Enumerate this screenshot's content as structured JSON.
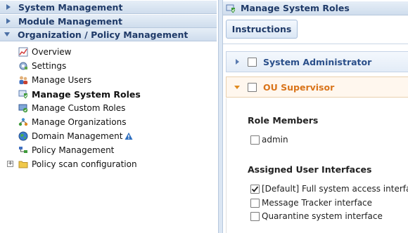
{
  "left": {
    "accordion": [
      {
        "label": "System Management",
        "expanded": false
      },
      {
        "label": "Module Management",
        "expanded": false
      },
      {
        "label": "Organization / Policy Management",
        "expanded": true
      }
    ],
    "tree": [
      {
        "label": "Overview",
        "icon": "overview-chart-icon"
      },
      {
        "label": "Settings",
        "icon": "settings-icon"
      },
      {
        "label": "Manage Users",
        "icon": "users-icon"
      },
      {
        "label": "Manage System Roles",
        "icon": "shield-check-icon",
        "active": true
      },
      {
        "label": "Manage Custom Roles",
        "icon": "monitor-check-icon"
      },
      {
        "label": "Manage Organizations",
        "icon": "organizations-icon"
      },
      {
        "label": "Domain Management",
        "icon": "globe-icon",
        "badge": "warning-icon"
      },
      {
        "label": "Policy Management",
        "icon": "policy-icon"
      },
      {
        "label": "Policy scan configuration",
        "icon": "folder-icon",
        "expander": "+"
      }
    ]
  },
  "right": {
    "title": "Manage System Roles",
    "instructions_label": "Instructions",
    "roles": [
      {
        "name": "System Administrator",
        "expanded": false,
        "checked": false
      },
      {
        "name": "OU Supervisor",
        "expanded": true,
        "checked": false
      }
    ],
    "role_members_title": "Role Members",
    "members": [
      {
        "label": "admin",
        "checked": false
      }
    ],
    "assigned_ui_title": "Assigned User Interfaces",
    "interfaces": [
      {
        "label": "[Default] Full system access interface",
        "checked": true
      },
      {
        "label": "Message Tracker interface",
        "checked": false
      },
      {
        "label": "Quarantine system interface",
        "checked": false
      }
    ]
  },
  "colors": {
    "header_text": "#1f3a68",
    "collapsed_role": "#2a4f8a",
    "expanded_role": "#d9741a"
  }
}
